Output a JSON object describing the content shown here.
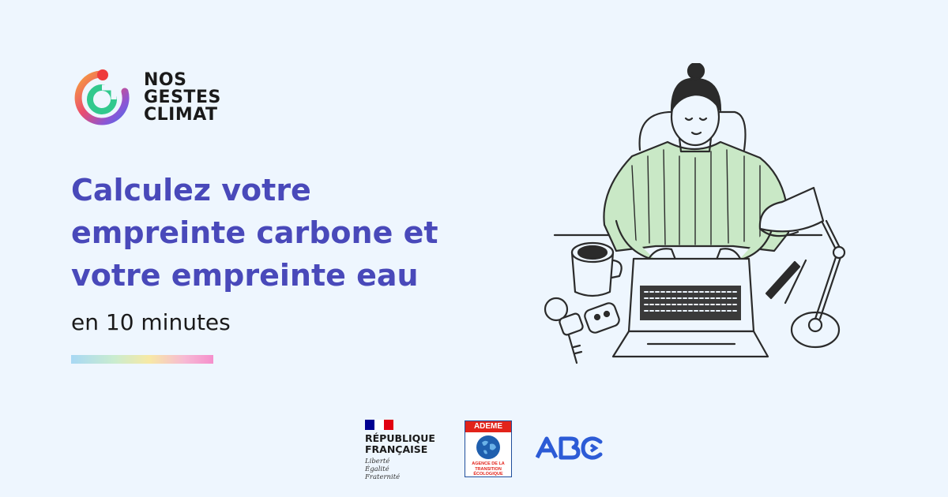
{
  "brand": {
    "line1": "NOS",
    "line2": "GESTES",
    "line3": "CLIMAT",
    "icon": "nos-gestes-climat-logo"
  },
  "headline": {
    "line1": "Calculez votre",
    "line2": "empreinte carbone et",
    "line3": "votre empreinte eau"
  },
  "subline": "en 10 minutes",
  "colors": {
    "background": "#eef6fe",
    "headline": "#4949ba",
    "text": "#1a1a1a",
    "sweater": "#c9e8c6",
    "flag_blue": "#000091",
    "flag_red": "#e1000f",
    "ademe_red": "#e2231a",
    "abc_blue": "#2c5bd6"
  },
  "illustration": {
    "description_icon": "woman-typing-laptop-illustration"
  },
  "partners": {
    "republique": {
      "line1": "RÉPUBLIQUE",
      "line2": "FRANÇAISE",
      "motto1": "Liberté",
      "motto2": "Égalité",
      "motto3": "Fraternité"
    },
    "ademe": {
      "name": "ADEME",
      "line1": "AGENCE DE LA",
      "line2": "TRANSITION",
      "line3": "ÉCOLOGIQUE"
    },
    "abc": {
      "name": "ABC"
    }
  }
}
